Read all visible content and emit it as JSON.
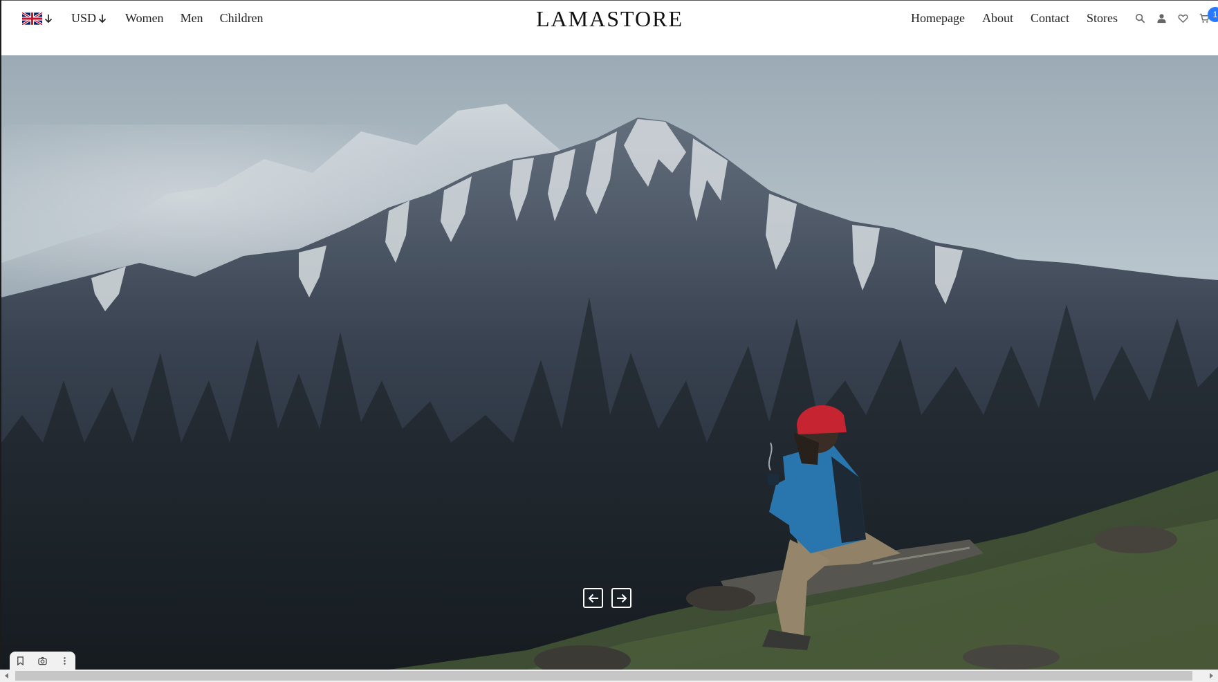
{
  "navbar": {
    "brand": "LAMASTORE",
    "left": {
      "language_icon": "flag-uk-icon",
      "currency_label": "USD",
      "links": [
        "Women",
        "Men",
        "Children"
      ]
    },
    "right": {
      "links": [
        "Homepage",
        "About",
        "Contact",
        "Stores"
      ],
      "icons": [
        "search-icon",
        "user-icon",
        "heart-icon",
        "cart-icon"
      ],
      "cart_count": "1"
    }
  },
  "hero": {
    "image": "mountain-landscape-with-hiker",
    "controls": [
      "arrow-left-icon",
      "arrow-right-icon"
    ]
  },
  "colors": {
    "accent": "#2879fe",
    "text": "#222222",
    "background": "#ffffff"
  },
  "browser_overlay": {
    "icons": [
      "bookmark-icon",
      "camera-icon",
      "more-vertical-icon"
    ]
  }
}
